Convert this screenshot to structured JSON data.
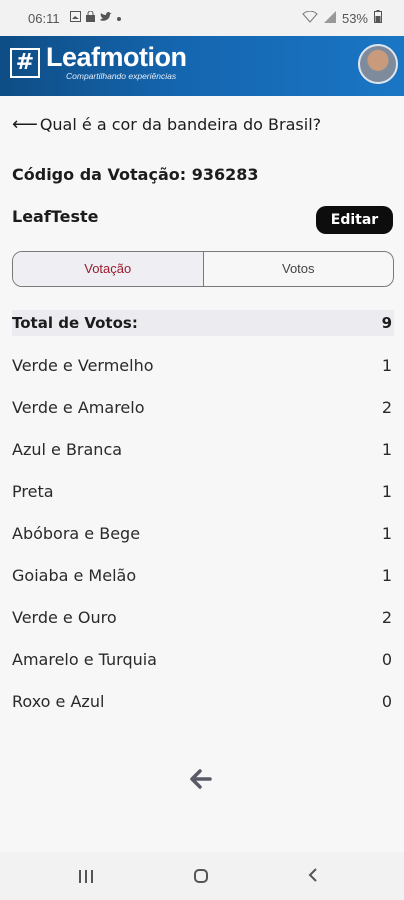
{
  "status_bar": {
    "time": "06:11",
    "battery": "53%",
    "icons": [
      "gallery-icon",
      "lock-icon",
      "twitter-icon",
      "dot-icon",
      "wifi-icon",
      "signal-icon",
      "battery-icon"
    ]
  },
  "header": {
    "logo_symbol": "#",
    "logo_text": "Leafmotion",
    "tagline": "Compartilhando experiências"
  },
  "poll": {
    "back_arrow": "⟵",
    "question": "Qual é a cor da bandeira do Brasil?",
    "code_label": "Código da Votação: 936283",
    "owner": "LeafTeste",
    "edit_label": "Editar"
  },
  "tabs": [
    {
      "label": "Votação",
      "active": true
    },
    {
      "label": "Votos",
      "active": false
    }
  ],
  "results": {
    "total_label": "Total de Votos:",
    "total_value": "9",
    "options": [
      {
        "label": "Verde e Vermelho",
        "votes": "1"
      },
      {
        "label": "Verde e Amarelo",
        "votes": "2"
      },
      {
        "label": "Azul e Branca",
        "votes": "1"
      },
      {
        "label": "Preta",
        "votes": "1"
      },
      {
        "label": "Abóbora e Bege",
        "votes": "1"
      },
      {
        "label": "Goiaba e Melão",
        "votes": "1"
      },
      {
        "label": "Verde e Ouro",
        "votes": "2"
      },
      {
        "label": "Amarelo e Turquia",
        "votes": "0"
      },
      {
        "label": "Roxo e Azul",
        "votes": "0"
      }
    ]
  },
  "bottom_back": "🡐",
  "colors": {
    "header_start": "#0e4d85",
    "header_end": "#1a76c4",
    "active_tab_text": "#9a1c2c",
    "edit_button": "#0d0d0d"
  }
}
